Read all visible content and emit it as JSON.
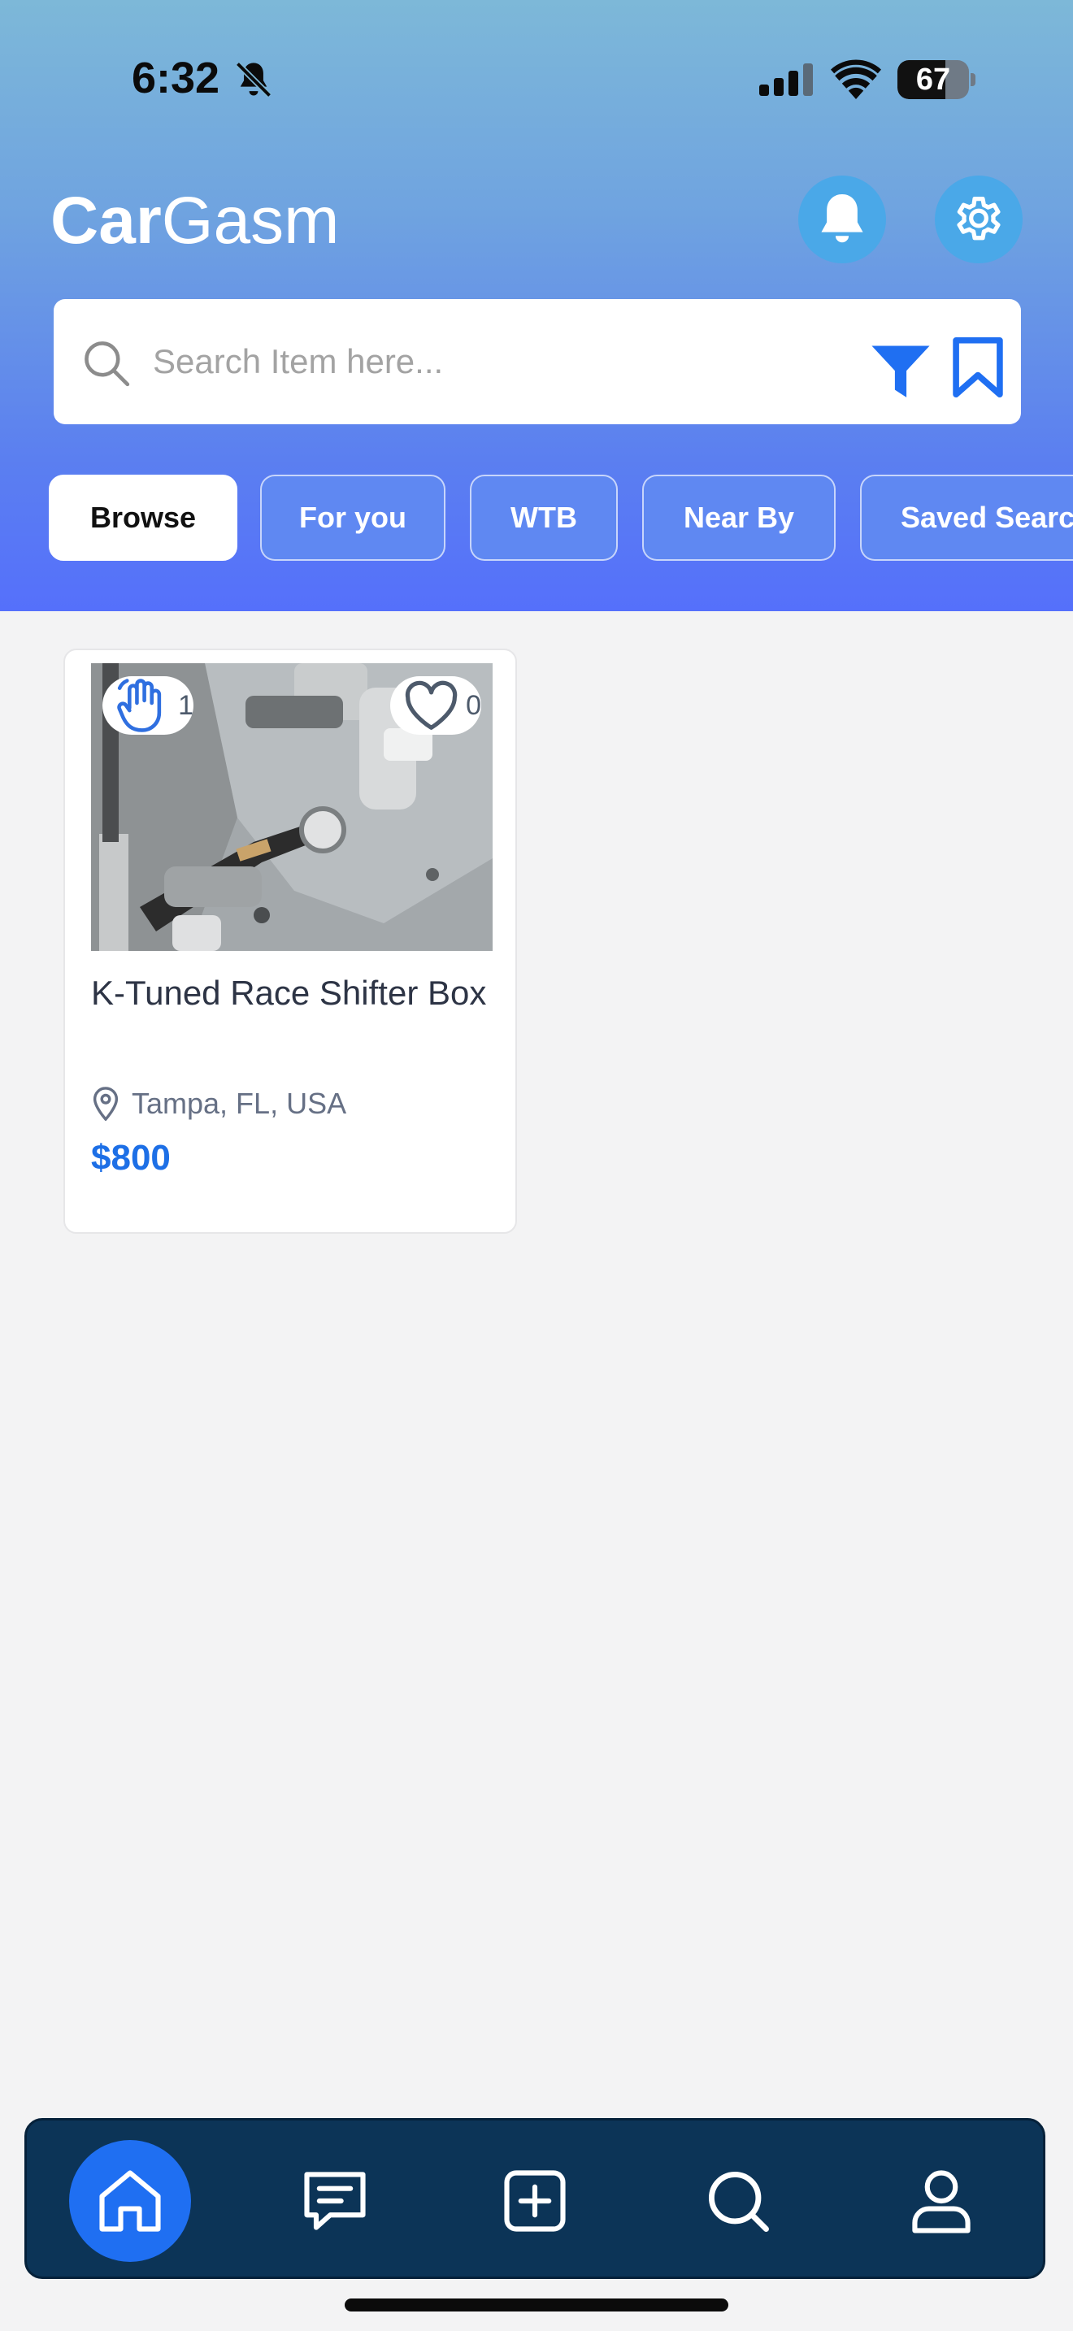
{
  "status_bar": {
    "time": "6:32",
    "battery_level": "67",
    "battery_fraction": 0.67
  },
  "header": {
    "title_bold": "Car",
    "title_regular": "Gasm"
  },
  "search": {
    "placeholder": "Search Item here..."
  },
  "tabs": [
    {
      "label": "Browse",
      "active": true
    },
    {
      "label": "For you",
      "active": false
    },
    {
      "label": "WTB",
      "active": false
    },
    {
      "label": "Near By",
      "active": false
    },
    {
      "label": "Saved Searc",
      "active": false
    }
  ],
  "listings": [
    {
      "title": "K-Tuned Race Shifter Box",
      "location": "Tampa, FL, USA",
      "price": "$800",
      "offers_count": "1",
      "likes_count": "0"
    }
  ],
  "bottom_nav": {
    "items": [
      {
        "icon": "home-icon",
        "active": true
      },
      {
        "icon": "chat-icon",
        "active": false
      },
      {
        "icon": "add-icon",
        "active": false
      },
      {
        "icon": "search-icon",
        "active": false
      },
      {
        "icon": "profile-icon",
        "active": false
      }
    ]
  },
  "colors": {
    "accent": "#1d6fe6",
    "header_top": "#7db8d8",
    "header_bottom": "#5570fb",
    "nav_background": "#0c3457"
  }
}
